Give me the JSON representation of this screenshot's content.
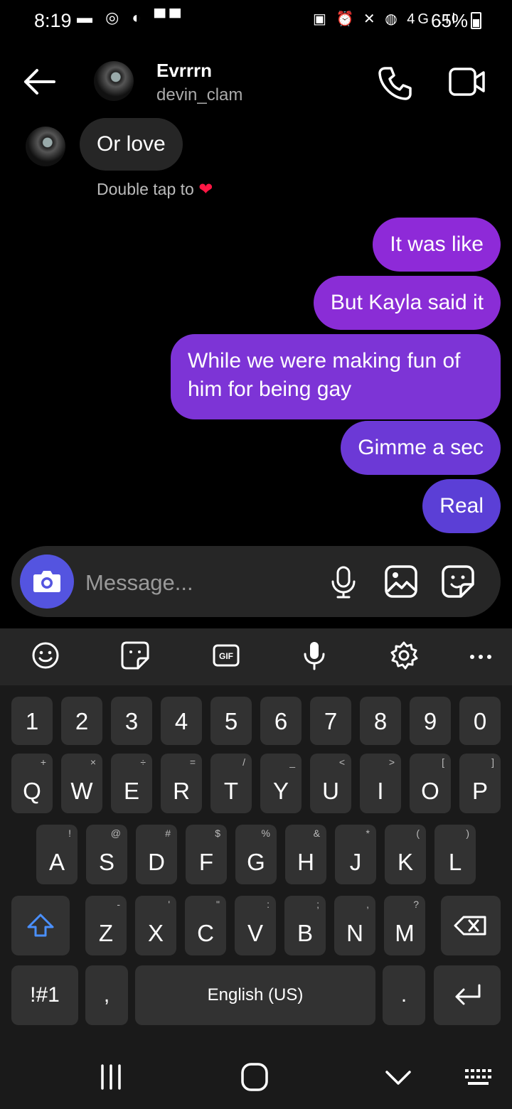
{
  "status": {
    "time": "8:19",
    "left_icons": "▬ ◎ ◐ ▀▀",
    "right_icons": "▣ ⏰ ✕ ◍ 4G .ıl",
    "battery": "65%"
  },
  "header": {
    "name": "Evrrrn",
    "username": "devin_clam"
  },
  "messages": {
    "incoming": "Or love",
    "double_tap": "Double tap to",
    "heart": "❤",
    "outgoing": [
      "It was like",
      "But Kayla said it",
      "While we were making fun of him for being gay",
      "Gimme a sec",
      "Real"
    ]
  },
  "composer": {
    "placeholder": "Message..."
  },
  "keyboard": {
    "numbers": [
      "1",
      "2",
      "3",
      "4",
      "5",
      "6",
      "7",
      "8",
      "9",
      "0"
    ],
    "row1": [
      {
        "k": "Q",
        "s": "+"
      },
      {
        "k": "W",
        "s": "×"
      },
      {
        "k": "E",
        "s": "÷"
      },
      {
        "k": "R",
        "s": "="
      },
      {
        "k": "T",
        "s": "/"
      },
      {
        "k": "Y",
        "s": "_"
      },
      {
        "k": "U",
        "s": "<"
      },
      {
        "k": "I",
        "s": ">"
      },
      {
        "k": "O",
        "s": "["
      },
      {
        "k": "P",
        "s": "]"
      }
    ],
    "row2": [
      {
        "k": "A",
        "s": "!"
      },
      {
        "k": "S",
        "s": "@"
      },
      {
        "k": "D",
        "s": "#"
      },
      {
        "k": "F",
        "s": "$"
      },
      {
        "k": "G",
        "s": "%"
      },
      {
        "k": "H",
        "s": "&"
      },
      {
        "k": "J",
        "s": "*"
      },
      {
        "k": "K",
        "s": "("
      },
      {
        "k": "L",
        "s": ")"
      }
    ],
    "row3": [
      {
        "k": "Z",
        "s": "-"
      },
      {
        "k": "X",
        "s": "'"
      },
      {
        "k": "C",
        "s": "\""
      },
      {
        "k": "V",
        "s": ":"
      },
      {
        "k": "B",
        "s": ";"
      },
      {
        "k": "N",
        "s": ","
      },
      {
        "k": "M",
        "s": "?"
      }
    ],
    "symbols": "!#1",
    "comma": ",",
    "space": "English (US)",
    "period": "."
  }
}
